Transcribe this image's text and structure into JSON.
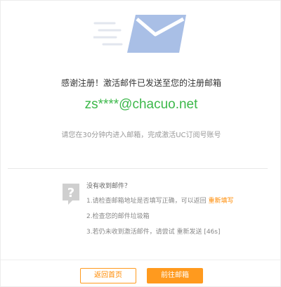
{
  "confirmation": {
    "title": "感谢注册！激活邮件已发送至您的注册邮箱",
    "email": "zs****@chacuo.net",
    "hint": "请您在30分钟内进入邮箱，完成激活UC订阅号账号"
  },
  "help": {
    "heading": "没有收到邮件？",
    "item1_text": "1.请检查邮箱地址是否填写正确，可以返回",
    "item1_link": "重新填写",
    "item2_text": "2.检查您的邮件垃圾箱",
    "item3_text": "3.若仍未收到激活邮件，请尝试 重新发送 [46s]"
  },
  "buttons": {
    "home_label": "返回首页",
    "mail_label": "前往邮箱"
  },
  "icons": {
    "envelope": "envelope-icon",
    "question": "question-icon"
  },
  "colors": {
    "accent": "#ff9a1e",
    "email_green": "#3cb84a",
    "envelope_blue": "#a9bfe6"
  }
}
